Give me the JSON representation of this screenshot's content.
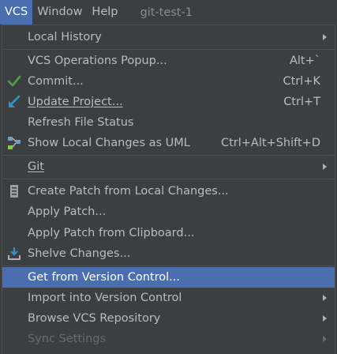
{
  "menubar": {
    "vcs": "VCS",
    "window": "Window",
    "help": "Help",
    "project_title": "git-test-1"
  },
  "menu": {
    "local_history": "Local History",
    "vcs_operations_popup": "VCS Operations Popup...",
    "vcs_operations_shortcut": "Alt+`",
    "commit": "Commit...",
    "commit_shortcut": "Ctrl+K",
    "update_project": "Update Project...",
    "update_project_shortcut": "Ctrl+T",
    "refresh_file_status": "Refresh File Status",
    "show_local_changes_uml": "Show Local Changes as UML",
    "show_local_changes_uml_shortcut": "Ctrl+Alt+Shift+D",
    "git": "Git",
    "create_patch": "Create Patch from Local Changes...",
    "apply_patch": "Apply Patch...",
    "apply_patch_clipboard": "Apply Patch from Clipboard...",
    "shelve_changes": "Shelve Changes...",
    "get_from_vcs": "Get from Version Control...",
    "import_into_vcs": "Import into Version Control",
    "browse_vcs_repository": "Browse VCS Repository",
    "sync_settings": "Sync Settings"
  },
  "colors": {
    "background": "#3c3f41",
    "highlight": "#4b6eaf",
    "commit_check": "#4fa04a",
    "update_arrow": "#3592c4"
  }
}
